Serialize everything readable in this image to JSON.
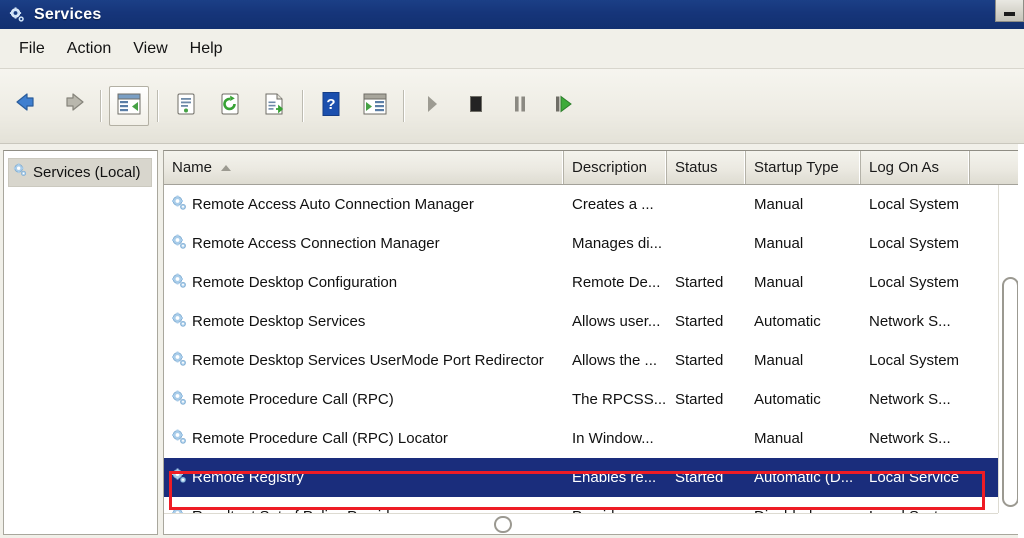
{
  "window": {
    "title": "Services",
    "icon": "services-gear-icon",
    "minimize_label": "Minimize"
  },
  "menubar": {
    "items": [
      {
        "label": "File"
      },
      {
        "label": "Action"
      },
      {
        "label": "View"
      },
      {
        "label": "Help"
      }
    ]
  },
  "toolbar": {
    "buttons": [
      {
        "name": "back-icon",
        "title": "Back"
      },
      {
        "name": "forward-icon",
        "title": "Forward"
      },
      {
        "name": "show-hide-tree-icon",
        "title": "Show/Hide Console Tree"
      },
      {
        "name": "properties-icon",
        "title": "Properties"
      },
      {
        "name": "refresh-icon",
        "title": "Refresh"
      },
      {
        "name": "export-list-icon",
        "title": "Export List"
      },
      {
        "name": "help-icon",
        "title": "Help"
      },
      {
        "name": "show-action-pane-icon",
        "title": "Show/Hide Action Pane"
      },
      {
        "name": "start-service-icon",
        "title": "Start Service"
      },
      {
        "name": "stop-service-icon",
        "title": "Stop Service"
      },
      {
        "name": "pause-service-icon",
        "title": "Pause Service"
      },
      {
        "name": "restart-service-icon",
        "title": "Restart Service"
      }
    ]
  },
  "tree": {
    "root_label": "Services (Local)",
    "root_icon": "services-gear-icon"
  },
  "list": {
    "columns": [
      {
        "key": "name",
        "label": "Name",
        "sorted": "asc"
      },
      {
        "key": "desc",
        "label": "Description",
        "sorted": ""
      },
      {
        "key": "status",
        "label": "Status",
        "sorted": ""
      },
      {
        "key": "startup",
        "label": "Startup Type",
        "sorted": ""
      },
      {
        "key": "logon",
        "label": "Log On As",
        "sorted": ""
      }
    ],
    "rows": [
      {
        "name": "Remote Access Auto Connection Manager",
        "desc": "Creates a ...",
        "status": "",
        "startup": "Manual",
        "logon": "Local System",
        "selected": false
      },
      {
        "name": "Remote Access Connection Manager",
        "desc": "Manages di...",
        "status": "",
        "startup": "Manual",
        "logon": "Local System",
        "selected": false
      },
      {
        "name": "Remote Desktop Configuration",
        "desc": "Remote De...",
        "status": "Started",
        "startup": "Manual",
        "logon": "Local System",
        "selected": false
      },
      {
        "name": "Remote Desktop Services",
        "desc": "Allows user...",
        "status": "Started",
        "startup": "Automatic",
        "logon": "Network S...",
        "selected": false
      },
      {
        "name": "Remote Desktop Services UserMode Port Redirector",
        "desc": "Allows the ...",
        "status": "Started",
        "startup": "Manual",
        "logon": "Local System",
        "selected": false
      },
      {
        "name": "Remote Procedure Call (RPC)",
        "desc": "The RPCSS...",
        "status": "Started",
        "startup": "Automatic",
        "logon": "Network S...",
        "selected": false
      },
      {
        "name": "Remote Procedure Call (RPC) Locator",
        "desc": "In Window...",
        "status": "",
        "startup": "Manual",
        "logon": "Network S...",
        "selected": false
      },
      {
        "name": "Remote Registry",
        "desc": "Enables re...",
        "status": "Started",
        "startup": "Automatic (D...",
        "logon": "Local Service",
        "selected": true
      },
      {
        "name": "Resultant Set of Policy Provider",
        "desc": "Provides a ...",
        "status": "",
        "startup": "Disabled",
        "logon": "Local System",
        "selected": false
      }
    ]
  },
  "annotation": {
    "type": "red-rectangle-highlight",
    "target_row": "Remote Registry",
    "color": "#ee1c25"
  },
  "colors": {
    "titlebar": "#163a80",
    "selection": "#1a2d7c",
    "accent_red": "#ee1c25",
    "chrome": "#f1f0e9"
  }
}
